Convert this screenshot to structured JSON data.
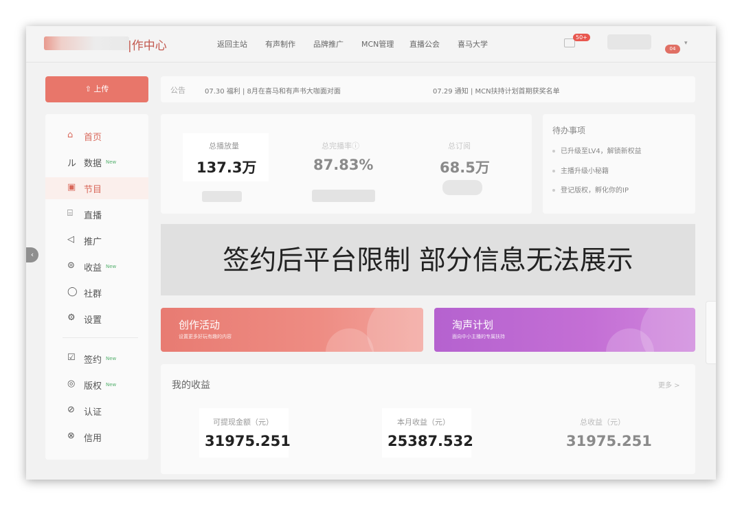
{
  "header": {
    "logo_text": "|作中心",
    "nav": [
      "返回主站",
      "有声制作",
      "品牌推广",
      "MCN管理",
      "直播公会",
      "喜马大学"
    ],
    "mail_badge": "50+",
    "avatar_badge": "04"
  },
  "upload": {
    "label": "上传"
  },
  "sidebar": {
    "items": [
      {
        "icon": "⌂",
        "label": "首页",
        "new": ""
      },
      {
        "icon": "ル",
        "label": "数据",
        "new": "New"
      },
      {
        "icon": "▣",
        "label": "节目",
        "new": ""
      },
      {
        "icon": "⌸",
        "label": "直播",
        "new": ""
      },
      {
        "icon": "◁",
        "label": "推广",
        "new": ""
      },
      {
        "icon": "⊜",
        "label": "收益",
        "new": "New"
      },
      {
        "icon": "◯",
        "label": "社群",
        "new": ""
      },
      {
        "icon": "⚙",
        "label": "设置",
        "new": ""
      },
      {
        "icon": "☑",
        "label": "签约",
        "new": "New"
      },
      {
        "icon": "◎",
        "label": "版权",
        "new": "New"
      },
      {
        "icon": "⊘",
        "label": "认证",
        "new": ""
      },
      {
        "icon": "⊗",
        "label": "信用",
        "new": ""
      }
    ]
  },
  "notice": {
    "tag": "公告",
    "item1": "07.30  福利 | 8月在喜马和有声书大咖面对面",
    "item2": "07.29  通知 | MCN扶持计划首期获奖名单"
  },
  "stats": {
    "total_plays_label": "总播放量",
    "total_plays": "137.3万",
    "completion_label": "总完播率ⓘ",
    "completion": "87.83%",
    "subs_label": "总订阅",
    "subs": "68.5万"
  },
  "todo": {
    "title": "待办事项",
    "items": [
      "已升级至LV4，解锁新权益",
      "主播升级小秘籍",
      "登记版权，孵化你的IP"
    ]
  },
  "banner": {
    "text": "签约后平台限制 部分信息无法展示"
  },
  "cards": {
    "activity_title": "创作活动",
    "activity_sub": "设置更多好玩有趣的内容",
    "plan_title": "淘声计划",
    "plan_sub": "面向中小主播的专属扶持"
  },
  "income": {
    "title": "我的收益",
    "more": "更多 >",
    "withdrawable_label": "可提现金额（元）",
    "withdrawable": "31975.251",
    "month_label": "本月收益（元）",
    "month": "25387.532",
    "total_label": "总收益（元）",
    "total": "31975.251"
  }
}
